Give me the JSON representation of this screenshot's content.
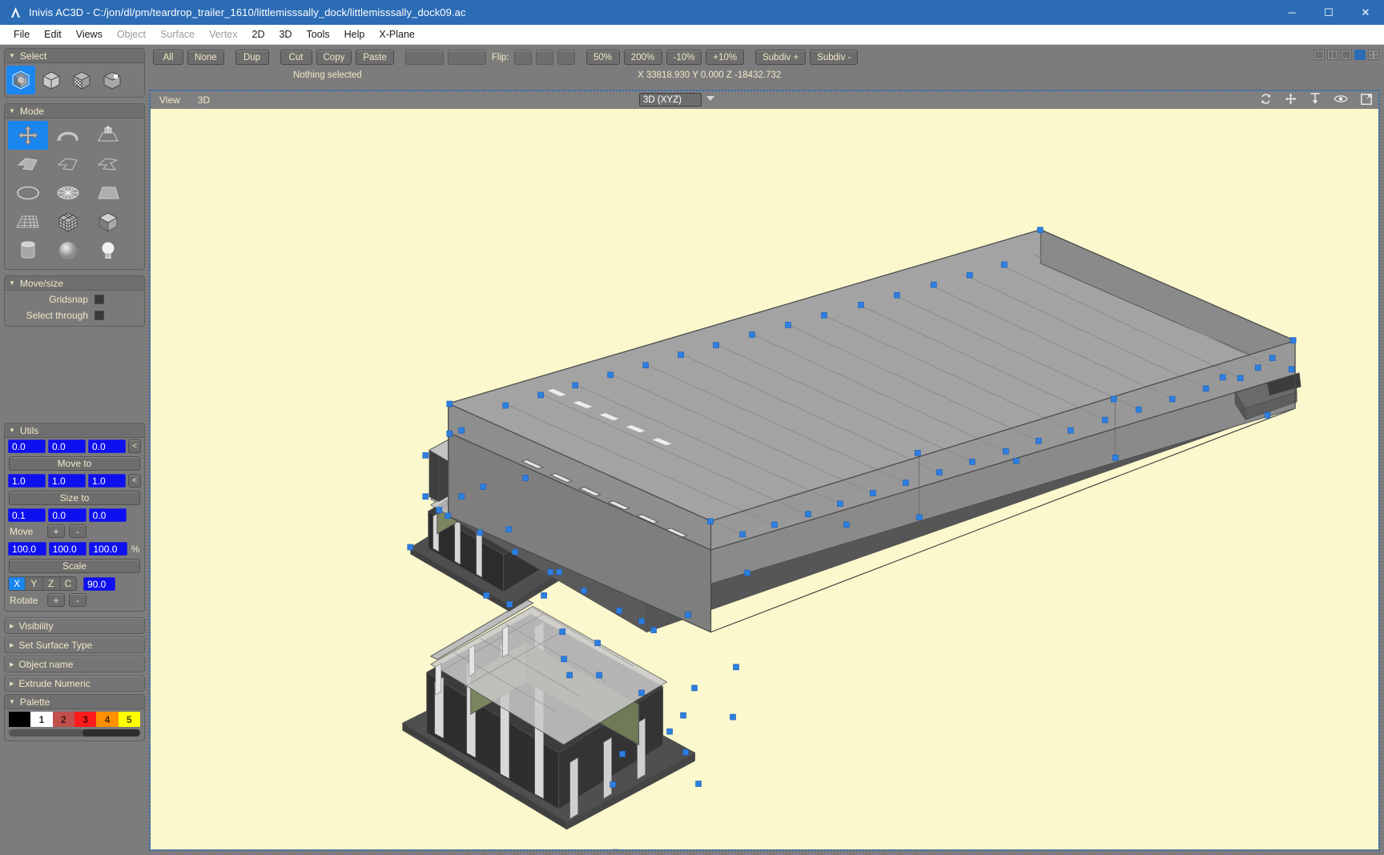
{
  "window": {
    "title": "Inivis AC3D - C:/jon/dl/pm/teardrop_trailer_1610/littlemisssally_dock/littlemisssally_dock09.ac",
    "app_icon": "ac3d-logo-icon",
    "minimize": "─",
    "maximize": "☐",
    "close": "✕"
  },
  "menu": {
    "items": [
      {
        "label": "File",
        "dim": false
      },
      {
        "label": "Edit",
        "dim": false
      },
      {
        "label": "Views",
        "dim": false
      },
      {
        "label": "Object",
        "dim": true
      },
      {
        "label": "Surface",
        "dim": true
      },
      {
        "label": "Vertex",
        "dim": true
      },
      {
        "label": "2D",
        "dim": false
      },
      {
        "label": "3D",
        "dim": false
      },
      {
        "label": "Tools",
        "dim": false
      },
      {
        "label": "Help",
        "dim": false
      },
      {
        "label": "X-Plane",
        "dim": false
      }
    ]
  },
  "toolbar": {
    "select_all": "All",
    "select_none": "None",
    "dup": "Dup",
    "cut": "Cut",
    "copy": "Copy",
    "paste": "Paste",
    "flip_label": "Flip:",
    "zoom_50": "50%",
    "zoom_200": "200%",
    "zoom_minus10": "-10%",
    "zoom_plus10": "+10%",
    "subdiv_plus": "Subdiv +",
    "subdiv_minus": "Subdiv -",
    "status": "Nothing selected",
    "coords": "X 33818.930 Y 0.000 Z -18432.732"
  },
  "select_panel": {
    "title": "Select",
    "icons": [
      {
        "name": "select-group-icon",
        "selected": true
      },
      {
        "name": "select-object-icon",
        "selected": false
      },
      {
        "name": "select-surface-icon",
        "selected": false
      },
      {
        "name": "select-vertex-icon",
        "selected": false
      }
    ]
  },
  "mode_panel": {
    "title": "Mode",
    "items": [
      {
        "name": "move-tool-icon",
        "selected": true
      },
      {
        "name": "rotate-tool-icon",
        "selected": false
      },
      {
        "name": "extrude-tool-icon",
        "selected": false
      },
      {
        "name": "surface-tool-icon",
        "selected": false
      },
      {
        "name": "knife-tool-icon",
        "selected": false
      },
      {
        "name": "bevel-tool-icon",
        "selected": false
      },
      {
        "name": "circle-primitive-icon",
        "selected": false
      },
      {
        "name": "disc-primitive-icon",
        "selected": false
      },
      {
        "name": "plane-primitive-icon",
        "selected": false
      },
      {
        "name": "grid-primitive-icon",
        "selected": false
      },
      {
        "name": "subdivided-cube-icon",
        "selected": false
      },
      {
        "name": "cube-primitive-icon",
        "selected": false
      },
      {
        "name": "cylinder-primitive-icon",
        "selected": false
      },
      {
        "name": "sphere-primitive-icon",
        "selected": false
      },
      {
        "name": "light-primitive-icon",
        "selected": false
      }
    ]
  },
  "movesize_panel": {
    "title": "Move/size",
    "gridsnap_label": "Gridsnap",
    "gridsnap_checked": false,
    "select_through_label": "Select through",
    "select_through_checked": false
  },
  "utils_panel": {
    "title": "Utils",
    "move_to": {
      "x": "0.0",
      "y": "0.0",
      "z": "0.0",
      "button": "Move to",
      "pick": "<"
    },
    "size_to": {
      "x": "1.0",
      "y": "1.0",
      "z": "1.0",
      "button": "Size to",
      "pick": "<"
    },
    "move_by": {
      "x": "0.1",
      "y": "0.0",
      "z": "0.0",
      "label": "Move",
      "plus": "+",
      "minus": "-"
    },
    "scale": {
      "x": "100.0",
      "y": "100.0",
      "z": "100.0",
      "unit": "%",
      "button": "Scale"
    },
    "rotate": {
      "axes": [
        {
          "label": "X",
          "on": true
        },
        {
          "label": "Y",
          "on": false
        },
        {
          "label": "Z",
          "on": false
        },
        {
          "label": "C",
          "on": false
        }
      ],
      "angle": "90.0",
      "label": "Rotate",
      "plus": "+",
      "minus": "-"
    }
  },
  "collapsed_panels": [
    {
      "title": "Visibility"
    },
    {
      "title": "Set Surface Type"
    },
    {
      "title": "Object name"
    },
    {
      "title": "Extrude Numeric"
    }
  ],
  "palette_panel": {
    "title": "Palette",
    "swatches": [
      {
        "label": "",
        "color": "#000000",
        "text_color": "#ffffff"
      },
      {
        "label": "1",
        "color": "#ffffff",
        "text_color": "#2a2a2a"
      },
      {
        "label": "2",
        "color": "#c0504d",
        "text_color": "#3a1414"
      },
      {
        "label": "3",
        "color": "#ff1b1b",
        "text_color": "#4a0000"
      },
      {
        "label": "4",
        "color": "#ff9000",
        "text_color": "#4a2800"
      },
      {
        "label": "5",
        "color": "#ffff00",
        "text_color": "#4a4a00"
      }
    ]
  },
  "viewport": {
    "menu_view": "View",
    "menu_3d": "3D",
    "projection": "3D (XYZ)",
    "icons": [
      {
        "name": "refresh-view-icon"
      },
      {
        "name": "pan-view-icon"
      },
      {
        "name": "zoom-fit-icon"
      },
      {
        "name": "eye-visibility-icon"
      },
      {
        "name": "maximize-view-icon"
      }
    ],
    "background_color": "#fbf8cd",
    "model_name": "littlemisssally_dock09",
    "surface_color": "#9d9d9d",
    "vertex_color": "#2e7fe0",
    "accent_color": "#2b6cb5"
  },
  "layout_icons": [
    {
      "name": "layout-single-icon",
      "active": false
    },
    {
      "name": "layout-vertical-split-icon",
      "active": false
    },
    {
      "name": "layout-horizontal-split-icon",
      "active": false
    },
    {
      "name": "layout-3d-only-icon",
      "active": true
    },
    {
      "name": "layout-quad-icon",
      "active": false
    }
  ]
}
